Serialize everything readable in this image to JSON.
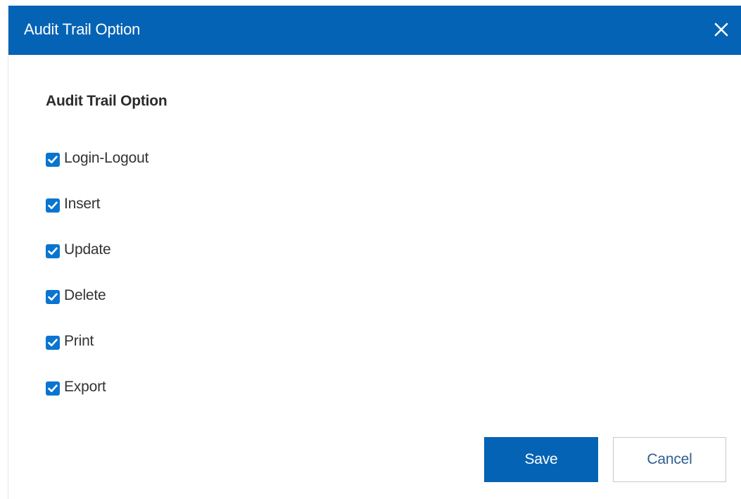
{
  "dialog": {
    "title": "Audit Trail Option",
    "close_icon": "close-icon",
    "header_color": "#0563b5"
  },
  "section": {
    "title": "Audit Trail Option"
  },
  "options": [
    {
      "label": "Login-Logout",
      "checked": true
    },
    {
      "label": "Insert",
      "checked": true
    },
    {
      "label": "Update",
      "checked": true
    },
    {
      "label": "Delete",
      "checked": true
    },
    {
      "label": "Print",
      "checked": true
    },
    {
      "label": "Export",
      "checked": true
    }
  ],
  "buttons": {
    "save_label": "Save",
    "cancel_label": "Cancel",
    "save_color": "#0563b5"
  },
  "checkbox_color": "#0a75d1"
}
